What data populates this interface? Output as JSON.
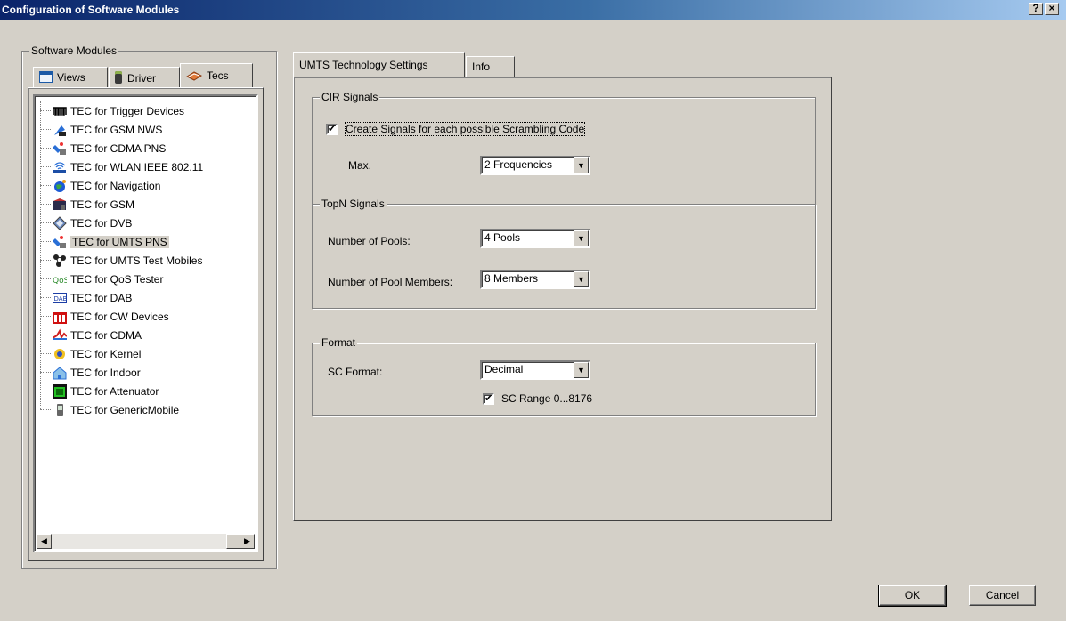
{
  "window": {
    "title": "Configuration of Software Modules",
    "help_label": "?",
    "close_label": "×"
  },
  "modules_group": {
    "label": "Software Modules",
    "tabs": [
      {
        "label": "Views",
        "icon": "window-icon"
      },
      {
        "label": "Driver",
        "icon": "phone-icon"
      },
      {
        "label": "Tecs",
        "icon": "tec-icon",
        "active": true
      }
    ],
    "tree_items": [
      {
        "label": "TEC for Trigger Devices",
        "icon": "trigger-icon"
      },
      {
        "label": "TEC for GSM NWS",
        "icon": "gsm-nws-icon"
      },
      {
        "label": "TEC for CDMA PNS",
        "icon": "satellite-icon"
      },
      {
        "label": "TEC for WLAN IEEE 802.11",
        "icon": "wlan-icon"
      },
      {
        "label": "TEC for Navigation",
        "icon": "globe-icon"
      },
      {
        "label": "TEC for GSM",
        "icon": "gsm-icon"
      },
      {
        "label": "TEC for DVB",
        "icon": "dvb-icon"
      },
      {
        "label": "TEC for UMTS PNS",
        "icon": "satellite-icon",
        "selected": true
      },
      {
        "label": "TEC for UMTS Test Mobiles",
        "icon": "network-icon"
      },
      {
        "label": "TEC for QoS Tester",
        "icon": "qos-icon"
      },
      {
        "label": "TEC for DAB",
        "icon": "dab-icon"
      },
      {
        "label": "TEC for CW Devices",
        "icon": "cw-icon"
      },
      {
        "label": "TEC for CDMA",
        "icon": "cdma-icon"
      },
      {
        "label": "TEC for Kernel",
        "icon": "kernel-icon"
      },
      {
        "label": "TEC for Indoor",
        "icon": "indoor-icon"
      },
      {
        "label": "TEC for Attenuator",
        "icon": "attenuator-icon"
      },
      {
        "label": "TEC for GenericMobile",
        "icon": "mobile-icon"
      }
    ],
    "scroll_left": "◀",
    "scroll_right": "▶"
  },
  "settings": {
    "tabs": [
      {
        "label": "UMTS Technology Settings",
        "active": true
      },
      {
        "label": "Info"
      }
    ],
    "cir_group": {
      "label": "CIR Signals",
      "create_signals_label": "Create Signals for each possible Scrambling Code",
      "create_signals_checked": true,
      "max_label": "Max.",
      "max_value": "2 Frequencies"
    },
    "topn_group": {
      "label": "TopN Signals",
      "pools_label": "Number of Pools:",
      "pools_value": "4 Pools",
      "members_label": "Number of Pool Members:",
      "members_value": "8 Members"
    },
    "format_group": {
      "label": "Format",
      "sc_format_label": "SC Format:",
      "sc_format_value": "Decimal",
      "sc_range_label": "SC Range 0...8176",
      "sc_range_checked": true
    }
  },
  "buttons": {
    "ok": "OK",
    "cancel": "Cancel"
  },
  "glyphs": {
    "check": "✔",
    "dropdown": "▼"
  }
}
